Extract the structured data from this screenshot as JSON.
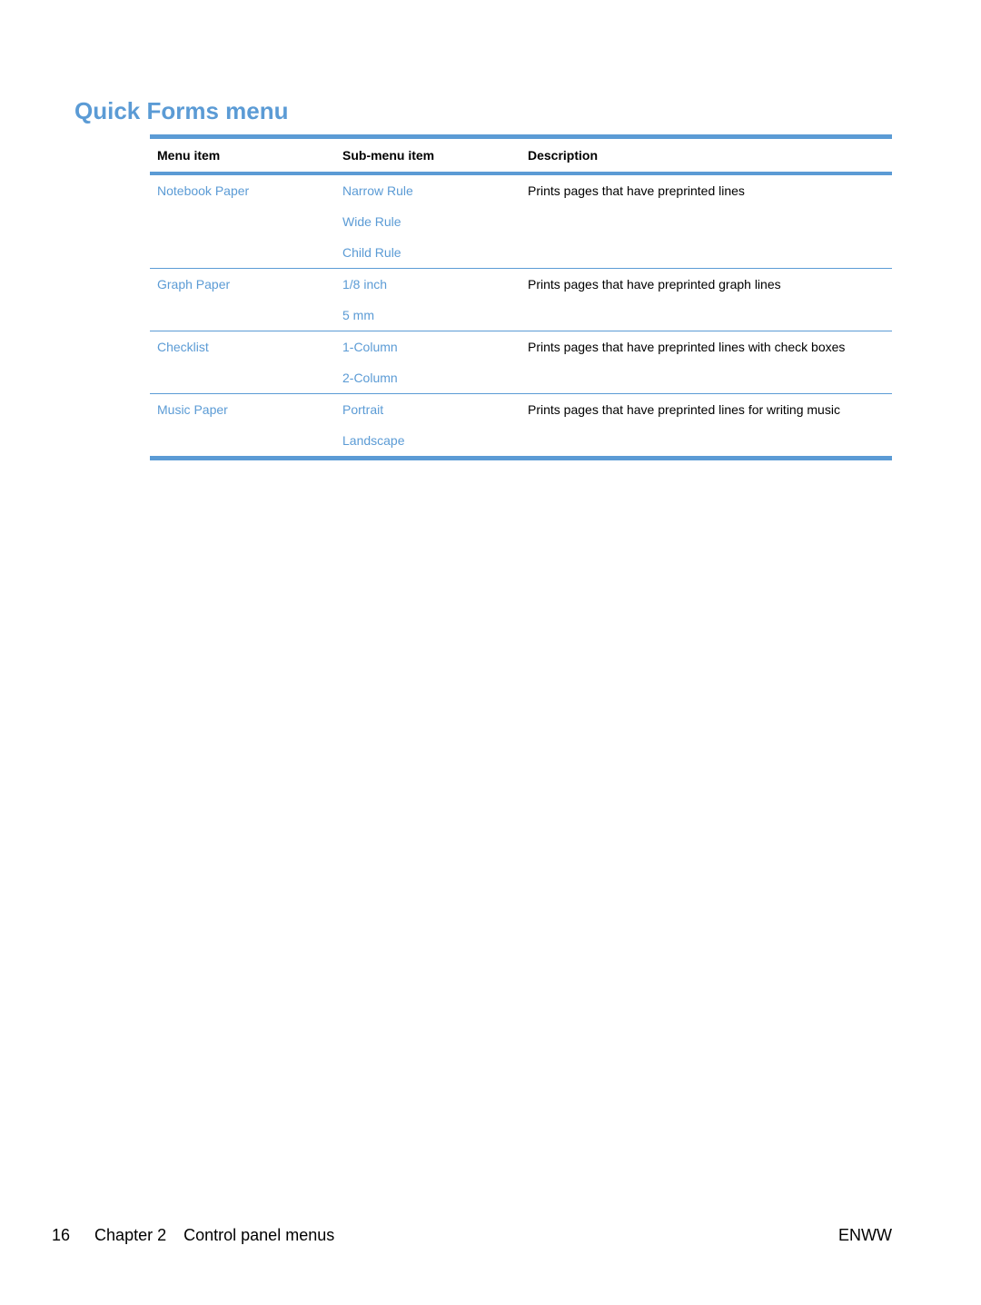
{
  "page": {
    "title": "Quick Forms menu",
    "accent_color": "#5b9bd5"
  },
  "table": {
    "headers": [
      "Menu item",
      "Sub-menu item",
      "Description"
    ],
    "groups": [
      {
        "menu_item": "Notebook Paper",
        "sub_items": [
          "Narrow Rule",
          "Wide Rule",
          "Child Rule"
        ],
        "description": "Prints pages that have preprinted lines"
      },
      {
        "menu_item": "Graph Paper",
        "sub_items": [
          "1/8 inch",
          "5 mm"
        ],
        "description": "Prints pages that have preprinted graph lines"
      },
      {
        "menu_item": "Checklist",
        "sub_items": [
          "1-Column",
          "2-Column"
        ],
        "description": "Prints pages that have preprinted lines with check boxes"
      },
      {
        "menu_item": "Music Paper",
        "sub_items": [
          "Portrait",
          "Landscape"
        ],
        "description": "Prints pages that have preprinted lines for writing music"
      }
    ]
  },
  "footer": {
    "page_number": "16",
    "chapter": "Chapter 2",
    "chapter_title": "Control panel menus",
    "locale": "ENWW"
  }
}
